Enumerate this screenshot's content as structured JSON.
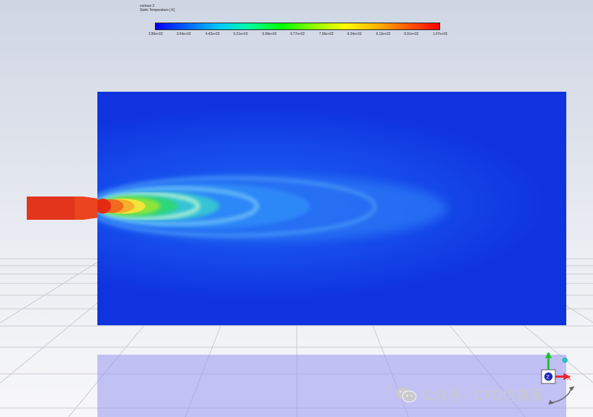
{
  "legend": {
    "contour_name": "contour-3",
    "variable": "Static Temperature [ K]",
    "colormap": [
      "#0000ff",
      "#0063ff",
      "#00c8ff",
      "#00ff9b",
      "#00ff00",
      "#8cff00",
      "#ffff00",
      "#ffb400",
      "#ff5a00",
      "#ff0000"
    ],
    "ticks": [
      "2.86e+02",
      "3.64e+02",
      "4.42e+02",
      "5.21e+02",
      "5.99e+02",
      "6.77e+02",
      "7.56e+02",
      "8.34e+02",
      "9.12e+02",
      "9.91e+02",
      "1.07e+03"
    ]
  },
  "plot": {
    "colors": {
      "ambient": "#1548ea",
      "jet_hot": "#e52a12",
      "plane_shadow": "#9696f0"
    }
  },
  "triad": {
    "axes": [
      "Y",
      "X",
      "Z"
    ],
    "axis_colors": {
      "x": "#e8232d",
      "y": "#1fbf30",
      "z": "#1f2ab5"
    }
  },
  "watermark": {
    "text": "公众号 · CFD仿真库",
    "icon": "wechat-icon"
  }
}
